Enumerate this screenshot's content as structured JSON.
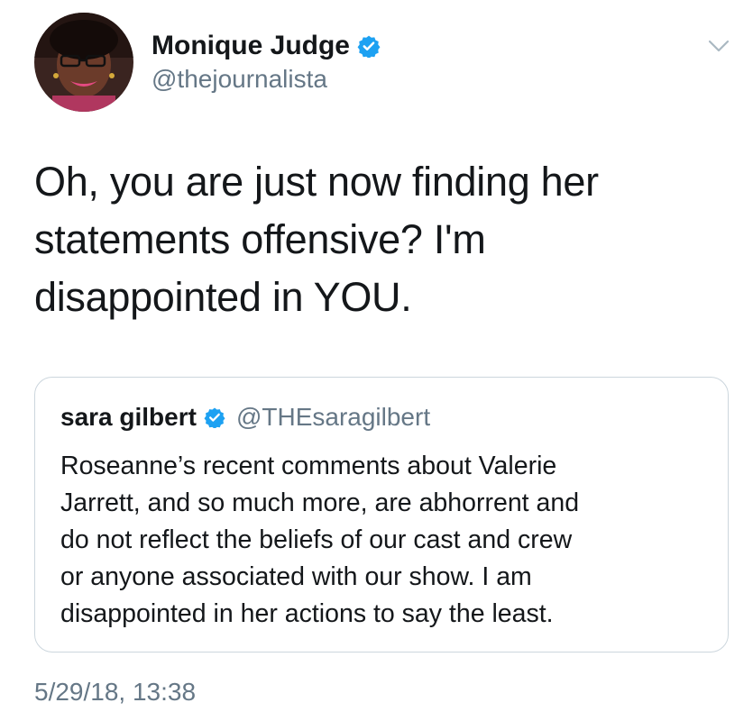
{
  "author": {
    "name": "Monique Judge",
    "handle": "@thejournalista",
    "verified_icon": "verified-badge-icon"
  },
  "tweet": {
    "text": "Oh, you are just now finding her\nstatements offensive? I'm\ndisappointed in YOU.",
    "timestamp": "5/29/18, 13:38"
  },
  "quoted_tweet": {
    "name": "sara gilbert",
    "handle": "@THEsaragilbert",
    "text": "Roseanne’s recent comments about Valerie\nJarrett, and so much more, are abhorrent and\ndo not reflect the beliefs of our cast and crew\nor anyone associated with our show. I am\ndisappointed in her actions to say the least."
  },
  "colors": {
    "text_primary": "#14171a",
    "text_secondary": "#657786",
    "verified_blue": "#1da1f2",
    "card_border": "#ccd6dd"
  }
}
